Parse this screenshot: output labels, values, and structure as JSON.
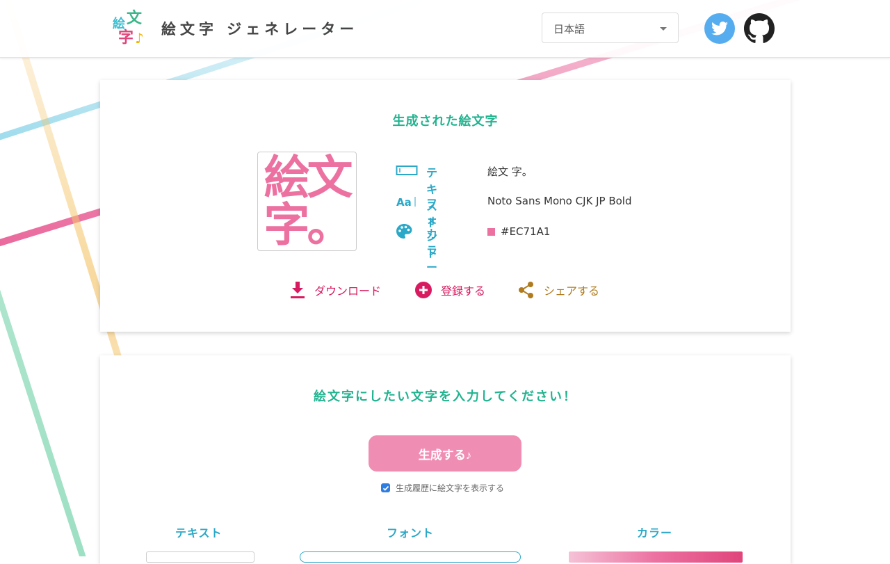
{
  "header": {
    "logo": {
      "c1": "絵",
      "c2": "文",
      "c3": "字",
      "c4": "♪"
    },
    "title": "絵文字 ジェネレーター",
    "language_select": {
      "value": "日本語"
    },
    "icons": {
      "twitter": "twitter-icon",
      "github": "github-icon"
    }
  },
  "result": {
    "title": "生成された絵文字",
    "preview": {
      "line1": "絵文",
      "line2": "字。",
      "color": "#EC71A1"
    },
    "text_label": "テキスト",
    "text_value": "絵文 字。",
    "font_label": "フォント",
    "font_value": "Noto Sans Mono CJK JP Bold",
    "color_label": "カラー",
    "color_value": "#EC71A1",
    "actions": {
      "download": "ダウンロード",
      "register": "登録する",
      "share": "シェアする"
    }
  },
  "form": {
    "title": "絵文字にしたい文字を入力してください！",
    "generate_button": "生成する♪",
    "history_checkbox": {
      "label": "生成履歴に絵文字を表示する",
      "checked": true
    },
    "columns": {
      "text": "テキスト",
      "font": "フォント",
      "color": "カラー"
    }
  },
  "colors": {
    "accent_green": "#21b38f",
    "accent_blue": "#2aa8c8",
    "emoji_pink": "#EC71A1",
    "button_pink": "#f08db3",
    "action_red": "#d81b60",
    "action_gold": "#b07b1f"
  }
}
